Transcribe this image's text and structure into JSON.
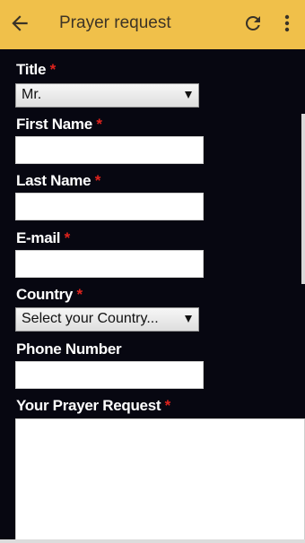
{
  "appbar": {
    "title": "Prayer request",
    "back_icon": "arrow-left-icon",
    "refresh_icon": "refresh-icon",
    "menu_icon": "more-vert-icon"
  },
  "form": {
    "required_mark": "*",
    "title_label": "Title",
    "title_value": "Mr.",
    "first_name_label": "First Name",
    "last_name_label": "Last Name",
    "email_label": "E-mail",
    "country_label": "Country",
    "country_value": "Select your Country...",
    "phone_label": "Phone Number",
    "prayer_label": "Your Prayer Request"
  },
  "colors": {
    "appbar": "#f0c04a",
    "background": "#070711",
    "required": "#e0231d"
  }
}
